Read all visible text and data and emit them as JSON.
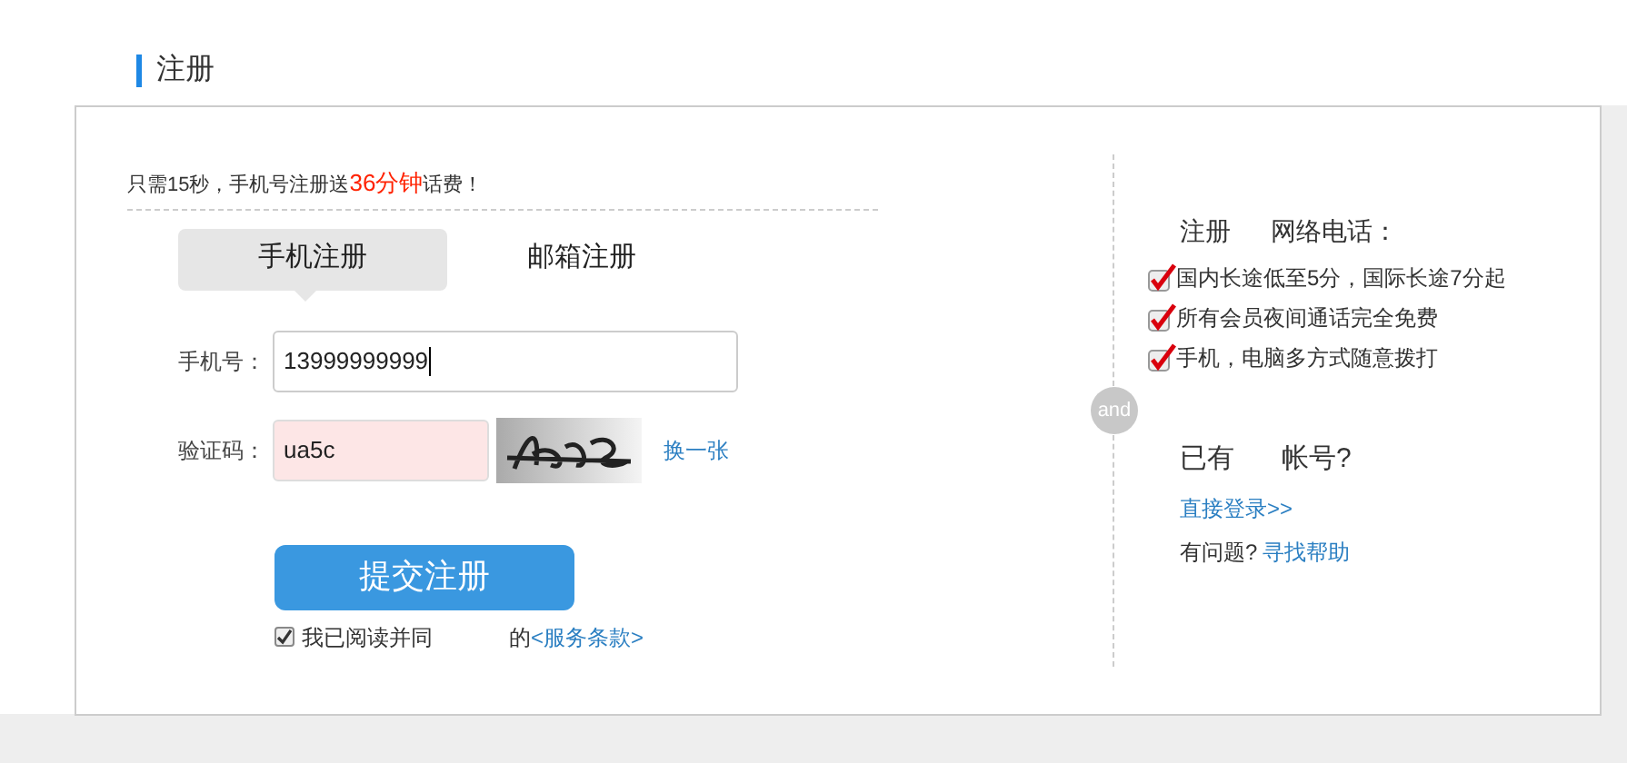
{
  "page_title": "注册",
  "promo": "只需15秒，手机号注册送**36分钟**话费！",
  "tabs": [
    {
      "label": "手机注册",
      "selected": true
    },
    {
      "label": "邮箱注册",
      "selected": false
    }
  ],
  "phone": {
    "label": "手机号：",
    "value": "13999999999"
  },
  "captcha": {
    "label": "验证码：",
    "value": "ua5c",
    "refresh": "换一张"
  },
  "submit": "提交注册",
  "agreement": {
    "checked": true,
    "text": "我已阅读并同",
    "text_2": "的",
    "link": "<服务条款>"
  },
  "divider_badge": "and",
  "benefits": {
    "heading": [
      "注册",
      "网络电话："
    ],
    "items": [
      "国内长途低至5分，国际长途7分起",
      "所有会员夜间通话完全免费",
      "手机，电脑多方式随意拨打"
    ]
  },
  "account": {
    "question": [
      "已有",
      "帐号?"
    ],
    "login_link": "直接登录>>",
    "help_label": "有问题?",
    "help_link": "寻找帮助"
  }
}
